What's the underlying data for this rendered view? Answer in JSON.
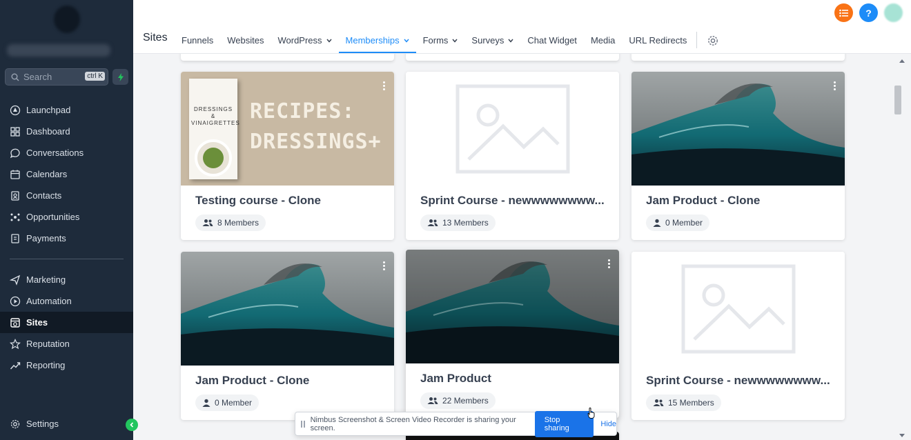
{
  "sidebar": {
    "search": {
      "placeholder": "Search",
      "shortcut": "ctrl K"
    },
    "items": [
      {
        "label": "Launchpad",
        "icon": "launchpad-icon"
      },
      {
        "label": "Dashboard",
        "icon": "dashboard-icon"
      },
      {
        "label": "Conversations",
        "icon": "chat-icon"
      },
      {
        "label": "Calendars",
        "icon": "calendar-icon"
      },
      {
        "label": "Contacts",
        "icon": "contacts-icon"
      },
      {
        "label": "Opportunities",
        "icon": "opportunities-icon"
      },
      {
        "label": "Payments",
        "icon": "payments-icon"
      }
    ],
    "items2": [
      {
        "label": "Marketing",
        "icon": "send-icon"
      },
      {
        "label": "Automation",
        "icon": "automation-icon"
      },
      {
        "label": "Sites",
        "icon": "sites-icon",
        "active": true
      },
      {
        "label": "Reputation",
        "icon": "star-icon"
      },
      {
        "label": "Reporting",
        "icon": "chart-icon"
      }
    ],
    "settings_label": "Settings"
  },
  "header": {
    "title": "Sites",
    "tabs": [
      {
        "label": "Funnels"
      },
      {
        "label": "Websites"
      },
      {
        "label": "WordPress",
        "dropdown": true
      },
      {
        "label": "Memberships",
        "dropdown": true,
        "active": true
      },
      {
        "label": "Forms",
        "dropdown": true
      },
      {
        "label": "Surveys",
        "dropdown": true
      },
      {
        "label": "Chat Widget"
      },
      {
        "label": "Media"
      },
      {
        "label": "URL Redirects"
      }
    ],
    "help_label": "?"
  },
  "cards": [
    {
      "title": "Testing course - Clone",
      "members": "8 Members",
      "image": "recipes"
    },
    {
      "title": "Sprint Course - newwwwwwww...",
      "members": "13 Members",
      "image": "placeholder"
    },
    {
      "title": "Jam Product - Clone",
      "members": "0 Member",
      "image": "wave"
    },
    {
      "title": "Jam Product - Clone",
      "members": "0 Member",
      "image": "wave"
    },
    {
      "title": "Jam Product",
      "members": "22 Members",
      "image": "wave"
    },
    {
      "title": "Sprint Course - newwwwwwww...",
      "members": "15 Members",
      "image": "placeholder"
    }
  ],
  "recipe_image": {
    "book_title": "DRESSINGS & VINAIGRETTES",
    "headline_1": "RECIPES:",
    "headline_2": "DRESSINGS+"
  },
  "share_banner": {
    "message": "Nimbus Screenshot & Screen Video Recorder is sharing your screen.",
    "stop_label": "Stop sharing",
    "hide_label": "Hide"
  },
  "colors": {
    "accent": "#1d8cf8",
    "sidebar": "#1e2b3b",
    "orange": "#f97316",
    "green": "#22c55e"
  }
}
